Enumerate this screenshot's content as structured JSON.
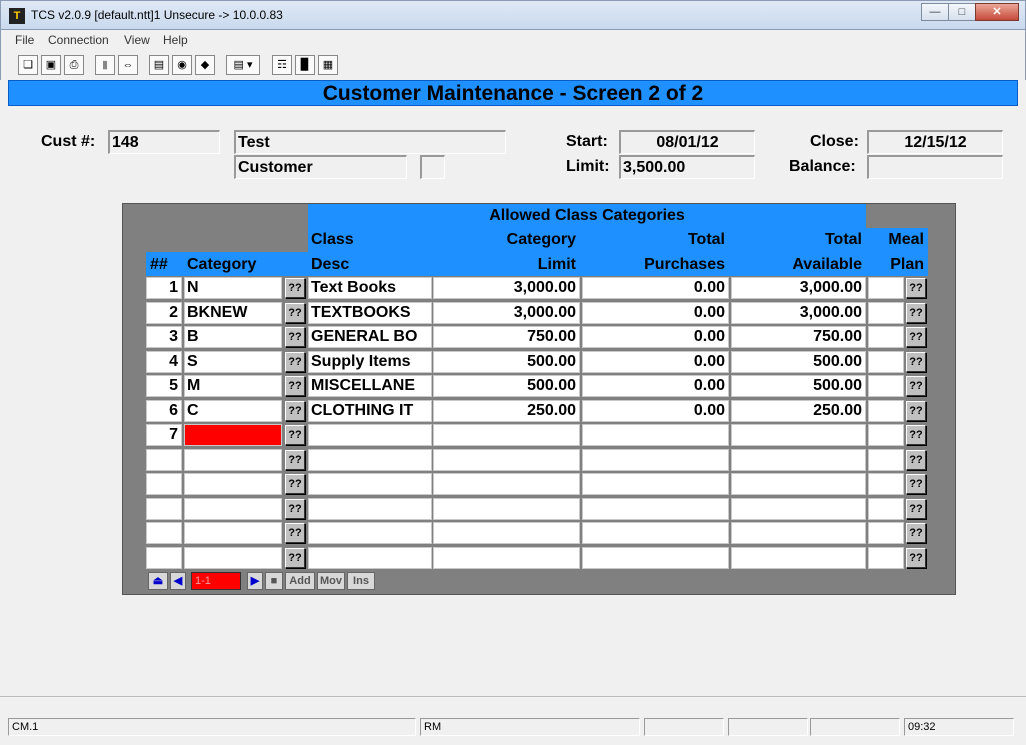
{
  "window": {
    "title": "TCS v2.0.9 [default.ntt]1 Unsecure -> 10.0.0.83",
    "app_icon": "T"
  },
  "menu": [
    "File",
    "Connection",
    "View",
    "Help"
  ],
  "toolbar_icons": [
    "copy-icon",
    "save-icon",
    "print-icon",
    "lock-icon",
    "connect-icon",
    "properties-icon",
    "monitor-icon",
    "eraser-icon",
    "screen-dropdown-icon",
    "tree-icon",
    "chart-icon",
    "calculator-icon"
  ],
  "header": {
    "title": "Customer Maintenance - Screen 2 of 2"
  },
  "form": {
    "cust_label": "Cust #:",
    "cust_value": "148",
    "name1": "Test",
    "name2": "Customer",
    "extra": "",
    "start_label": "Start:",
    "start_value": "08/01/12",
    "close_label": "Close:",
    "close_value": "12/15/12",
    "limit_label": "Limit:",
    "limit_value": "3,500.00",
    "balance_label": "Balance:",
    "balance_value": ""
  },
  "grid": {
    "group_header": "Allowed Class Categories",
    "col_num": "##",
    "col_category": "Category",
    "col_class_1": "Class",
    "col_class_2": "Desc",
    "col_limit_1": "Category",
    "col_limit_2": "Limit",
    "col_purch_1": "Total",
    "col_purch_2": "Purchases",
    "col_avail_1": "Total",
    "col_avail_2": "Available",
    "col_meal_1": "Meal",
    "col_meal_2": "Plan",
    "lookup_label": "??",
    "rows": [
      {
        "num": "1",
        "category": "N",
        "desc": "Text Books",
        "limit": "3,000.00",
        "purchases": "0.00",
        "available": "3,000.00",
        "meal": ""
      },
      {
        "num": "2",
        "category": "BKNEW",
        "desc": "TEXTBOOKS",
        "limit": "3,000.00",
        "purchases": "0.00",
        "available": "3,000.00",
        "meal": ""
      },
      {
        "num": "3",
        "category": "B",
        "desc": "GENERAL BO",
        "limit": "750.00",
        "purchases": "0.00",
        "available": "750.00",
        "meal": ""
      },
      {
        "num": "4",
        "category": "S",
        "desc": "Supply Items",
        "limit": "500.00",
        "purchases": "0.00",
        "available": "500.00",
        "meal": ""
      },
      {
        "num": "5",
        "category": "M",
        "desc": "MISCELLANE",
        "limit": "500.00",
        "purchases": "0.00",
        "available": "500.00",
        "meal": ""
      },
      {
        "num": "6",
        "category": "C",
        "desc": "CLOTHING IT",
        "limit": "250.00",
        "purchases": "0.00",
        "available": "250.00",
        "meal": ""
      },
      {
        "num": "7",
        "category": "",
        "desc": "",
        "limit": "",
        "purchases": "",
        "available": "",
        "meal": ""
      },
      {
        "num": "",
        "category": "",
        "desc": "",
        "limit": "",
        "purchases": "",
        "available": "",
        "meal": ""
      },
      {
        "num": "",
        "category": "",
        "desc": "",
        "limit": "",
        "purchases": "",
        "available": "",
        "meal": ""
      },
      {
        "num": "",
        "category": "",
        "desc": "",
        "limit": "",
        "purchases": "",
        "available": "",
        "meal": ""
      },
      {
        "num": "",
        "category": "",
        "desc": "",
        "limit": "",
        "purchases": "",
        "available": "",
        "meal": ""
      },
      {
        "num": "",
        "category": "",
        "desc": "",
        "limit": "",
        "purchases": "",
        "available": "",
        "meal": ""
      }
    ],
    "nav": {
      "position": "1-1",
      "add": "Add",
      "mov": "Mov",
      "ins": "Ins"
    }
  },
  "status": {
    "left": "CM.1",
    "mode": "RM",
    "time": "09:32"
  },
  "colors": {
    "accent_blue": "#1e90ff",
    "active_cell": "#ff0000"
  }
}
